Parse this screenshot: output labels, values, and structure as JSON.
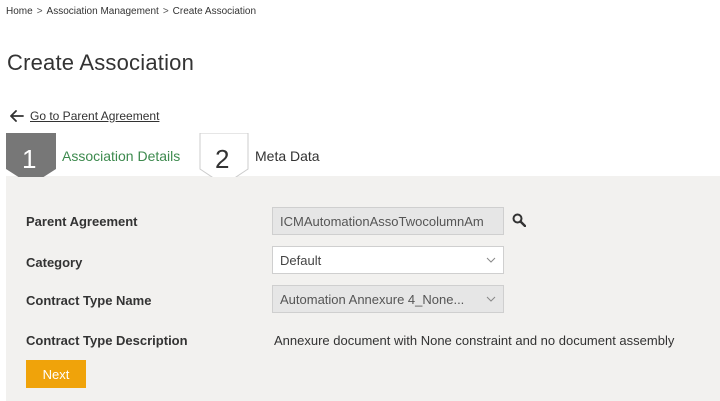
{
  "breadcrumb": {
    "items": [
      "Home",
      "Association Management",
      "Create Association"
    ],
    "separator": ">"
  },
  "page": {
    "title": "Create Association",
    "back_link": "Go to Parent Agreement"
  },
  "steps": [
    {
      "number": "1",
      "label": "Association Details",
      "active": true
    },
    {
      "number": "2",
      "label": "Meta Data",
      "active": false
    }
  ],
  "form": {
    "parent_agreement": {
      "label": "Parent Agreement",
      "value": "ICMAutomationAssoTwocolumnAm"
    },
    "category": {
      "label": "Category",
      "value": "Default"
    },
    "contract_type_name": {
      "label": "Contract Type Name",
      "value": "Automation Annexure 4_None..."
    },
    "contract_type_description": {
      "label": "Contract Type Description",
      "value": "Annexure document with None constraint and no document assembly"
    }
  },
  "actions": {
    "next_label": "Next"
  },
  "colors": {
    "accent": "#f0a30a",
    "active_step_bg": "#777777",
    "active_step_text": "#3d8a4e",
    "panel_bg": "#f2f1ef"
  }
}
